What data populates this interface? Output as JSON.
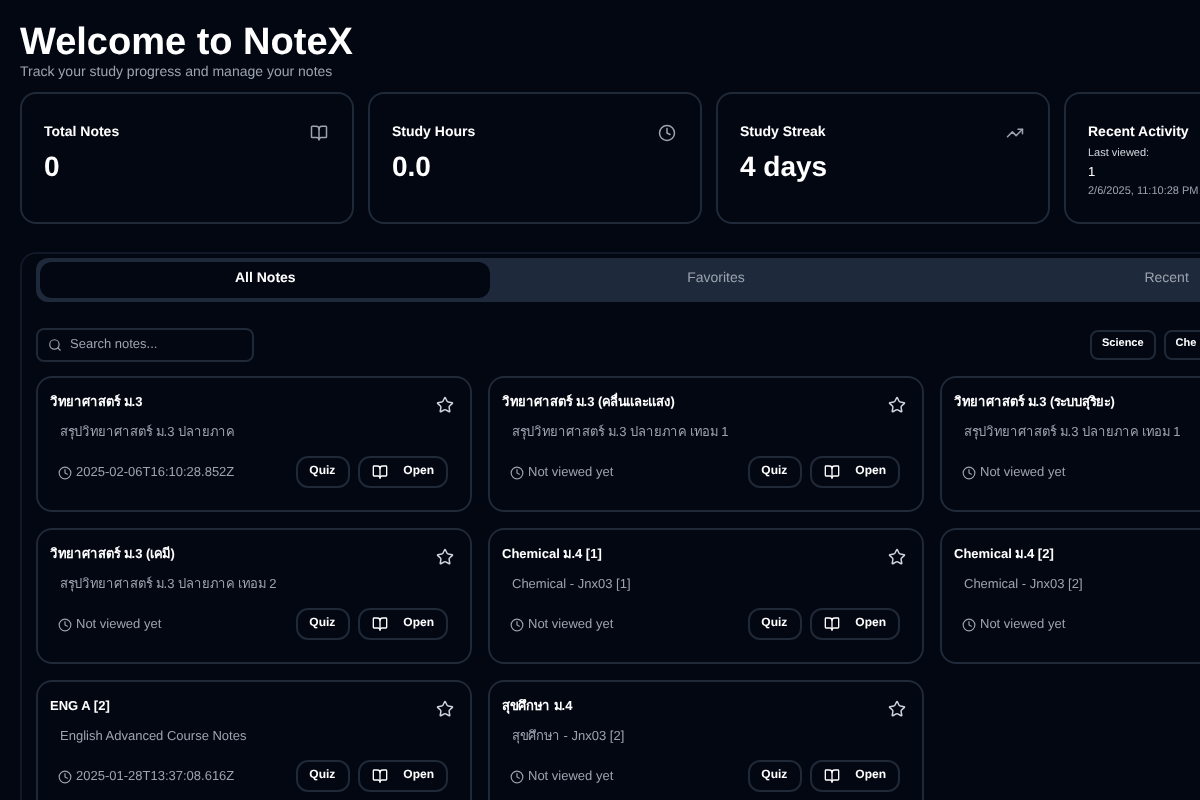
{
  "header": {
    "title": "Welcome to NoteX",
    "subtitle": "Track your study progress and manage your notes"
  },
  "stats": [
    {
      "kind": "value",
      "title": "Total Notes",
      "value": "0"
    },
    {
      "kind": "value",
      "title": "Study Hours",
      "value": "0.0"
    },
    {
      "kind": "value",
      "title": "Study Streak",
      "value": "4 days"
    },
    {
      "kind": "activity",
      "title": "Recent Activity",
      "label": "Last viewed:",
      "value": "1",
      "time": "2/6/2025, 11:10:28 PM"
    }
  ],
  "tabs": [
    {
      "label": "All Notes",
      "selected": true
    },
    {
      "label": "Favorites",
      "selected": false
    },
    {
      "label": "Recent",
      "selected": false
    }
  ],
  "search": {
    "placeholder": "Search notes..."
  },
  "filters": [
    "Science",
    "Che"
  ],
  "notes": [
    {
      "title": "วิทยาศาสตร์ ม.3",
      "description": "สรุปวิทยาศาสตร์ ม.3 ปลายภาค",
      "time": "2025-02-06T16:10:28.852Z",
      "buttons": [
        "Quiz",
        "Open"
      ]
    },
    {
      "title": "วิทยาศาสตร์ ม.3 (คลื่นและแสง)",
      "description": "สรุปวิทยาศาสตร์ ม.3 ปลายภาค เทอม 1",
      "time": "Not viewed yet",
      "buttons": [
        "Quiz",
        "Open"
      ]
    },
    {
      "title": "วิทยาศาสตร์ ม.3 (ระบบสุริยะ)",
      "description": "สรุปวิทยาศาสตร์ ม.3 ปลายภาค เทอม 1",
      "time": "Not viewed yet"
    },
    {
      "title": "วิทยาศาสตร์ ม.3 (เคมี)",
      "description": "สรุปวิทยาศาสตร์ ม.3 ปลายภาค เทอม 2",
      "time": "Not viewed yet",
      "buttons": [
        "Quiz",
        "Open"
      ]
    },
    {
      "title": "Chemical ม.4 [1]",
      "description": "Chemical - Jnx03 [1]",
      "time": "Not viewed yet",
      "buttons": [
        "Quiz",
        "Open"
      ]
    },
    {
      "title": "Chemical ม.4 [2]",
      "description": "Chemical - Jnx03 [2]",
      "time": "Not viewed yet"
    },
    {
      "title": "ENG A [2]",
      "description": "English Advanced Course Notes",
      "time": "2025-01-28T13:37:08.616Z",
      "buttons": [
        "Quiz",
        "Open"
      ]
    },
    {
      "title": "สุขศึกษา ม.4",
      "description": "สุขศึกษา - Jnx03 [2]",
      "time": "Not viewed yet",
      "buttons": [
        "Quiz",
        "Open"
      ]
    }
  ]
}
